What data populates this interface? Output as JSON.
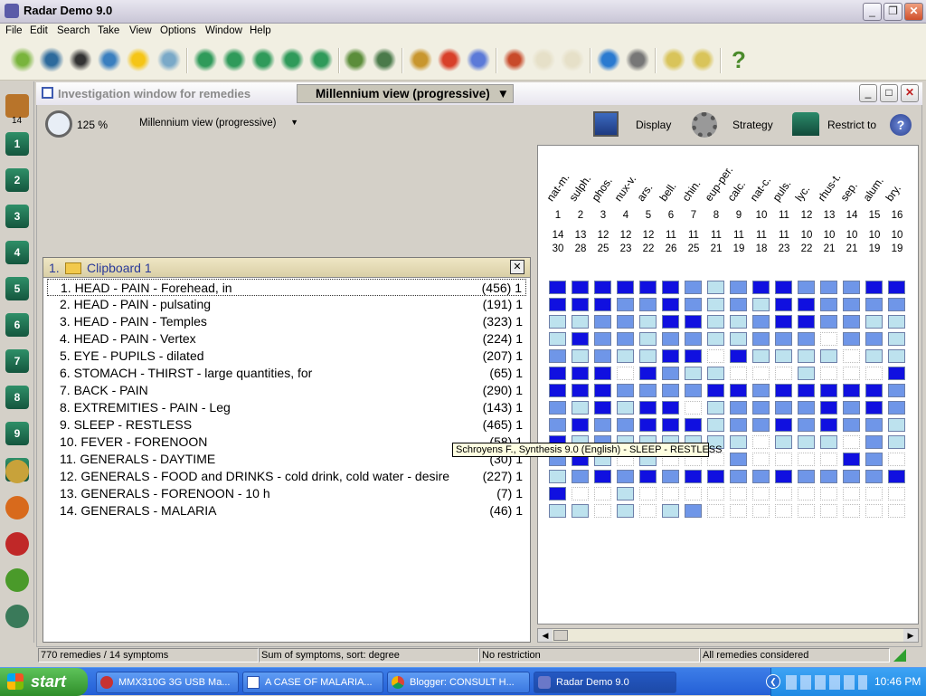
{
  "window": {
    "title": "Radar Demo 9.0"
  },
  "menu": [
    "File",
    "Edit",
    "Search",
    "Take",
    "View",
    "Options",
    "Window",
    "Help"
  ],
  "toolbar_icons": [
    "open-book-icon",
    "binoculars-icon",
    "glasses-icon",
    "magnifier-icon",
    "lightbulb-icon",
    "stopwatch-icon",
    "clip-1-icon",
    "clip-2-icon",
    "clip-3-icon",
    "clip-4-icon",
    "clip-5-icon",
    "chart-icon",
    "test-tubes-icon",
    "target-icon",
    "pie-icon",
    "circle-icon",
    "pencil-icon",
    "scroll-icon",
    "scroll2-icon",
    "globe-icon",
    "printer-icon",
    "chip-icon",
    "chip2-icon",
    "help-icon"
  ],
  "left_toolbar": {
    "clipboard_count": "14",
    "items": [
      "1",
      "2",
      "3",
      "4",
      "5",
      "6",
      "7",
      "8",
      "9",
      "10"
    ]
  },
  "inner": {
    "inactive_tab": "Investigation window for remedies",
    "active_tab": "Millennium view (progressive)",
    "zoom": "125 %",
    "view_select": "Millennium view (progressive)",
    "display": "Display",
    "strategy": "Strategy",
    "restrict": "Restrict to"
  },
  "clipboard": {
    "number": "1.",
    "title": "Clipboard 1",
    "rows": [
      {
        "label": "1. HEAD - PAIN - Forehead, in",
        "count": "(456) 1"
      },
      {
        "label": "2. HEAD - PAIN - pulsating",
        "count": "(191) 1"
      },
      {
        "label": "3. HEAD - PAIN - Temples",
        "count": "(323) 1"
      },
      {
        "label": "4. HEAD - PAIN - Vertex",
        "count": "(224) 1"
      },
      {
        "label": "5. EYE - PUPILS - dilated",
        "count": "(207) 1"
      },
      {
        "label": "6. STOMACH - THIRST - large quantities, for",
        "count": "(65) 1"
      },
      {
        "label": "7. BACK - PAIN",
        "count": "(290) 1"
      },
      {
        "label": "8. EXTREMITIES - PAIN - Leg",
        "count": "(143) 1"
      },
      {
        "label": "9. SLEEP - RESTLESS",
        "count": "(465) 1"
      },
      {
        "label": "10. FEVER - FORENOON",
        "count": "(58) 1"
      },
      {
        "label": "11. GENERALS - DAYTIME",
        "count": "(30) 1"
      },
      {
        "label": "12. GENERALS - FOOD and DRINKS - cold drink, cold water - desire",
        "count": "(227) 1"
      },
      {
        "label": "13. GENERALS - FORENOON - 10 h",
        "count": "(7) 1"
      },
      {
        "label": "14. GENERALS - MALARIA",
        "count": "(46) 1"
      }
    ]
  },
  "grid": {
    "remedies": [
      "nat-m.",
      "sulph.",
      "phos.",
      "nux-v.",
      "ars.",
      "bell.",
      "chin.",
      "eup-per.",
      "calc.",
      "nat-c.",
      "puls.",
      "lyc.",
      "rhus-t.",
      "sep.",
      "alum.",
      "bry."
    ],
    "ranks": [
      "1",
      "2",
      "3",
      "4",
      "5",
      "6",
      "7",
      "8",
      "9",
      "10",
      "11",
      "12",
      "13",
      "14",
      "15",
      "16"
    ],
    "symptom_counts": [
      "14",
      "13",
      "12",
      "12",
      "12",
      "11",
      "11",
      "11",
      "11",
      "11",
      "11",
      "10",
      "10",
      "10",
      "10",
      "10"
    ],
    "degrees": [
      "30",
      "28",
      "25",
      "23",
      "22",
      "26",
      "25",
      "21",
      "19",
      "18",
      "23",
      "22",
      "21",
      "21",
      "19",
      "19"
    ],
    "levels": [
      [
        3,
        3,
        3,
        3,
        3,
        3,
        2,
        1,
        2,
        3,
        3,
        2,
        2,
        2,
        3,
        3
      ],
      [
        3,
        3,
        3,
        2,
        2,
        3,
        2,
        1,
        2,
        1,
        3,
        3,
        2,
        2,
        2,
        2
      ],
      [
        1,
        1,
        2,
        2,
        1,
        3,
        3,
        1,
        1,
        2,
        3,
        3,
        2,
        2,
        1,
        1
      ],
      [
        1,
        3,
        2,
        2,
        1,
        2,
        2,
        1,
        1,
        2,
        2,
        2,
        0,
        2,
        2,
        1
      ],
      [
        2,
        1,
        2,
        1,
        1,
        3,
        3,
        0,
        3,
        1,
        1,
        1,
        1,
        0,
        1,
        1
      ],
      [
        3,
        3,
        3,
        0,
        3,
        2,
        1,
        1,
        0,
        0,
        0,
        1,
        0,
        0,
        0,
        3
      ],
      [
        3,
        3,
        3,
        2,
        2,
        2,
        2,
        3,
        3,
        2,
        3,
        3,
        3,
        3,
        3,
        2
      ],
      [
        2,
        1,
        3,
        1,
        3,
        3,
        0,
        1,
        2,
        2,
        2,
        2,
        3,
        2,
        3,
        2
      ],
      [
        2,
        3,
        2,
        2,
        3,
        3,
        3,
        1,
        2,
        2,
        3,
        2,
        3,
        2,
        2,
        1
      ],
      [
        3,
        1,
        2,
        1,
        1,
        1,
        1,
        1,
        1,
        0,
        1,
        1,
        1,
        0,
        2,
        1
      ],
      [
        2,
        3,
        1,
        0,
        1,
        0,
        0,
        0,
        2,
        0,
        0,
        0,
        0,
        3,
        2,
        0
      ],
      [
        1,
        2,
        3,
        2,
        3,
        2,
        3,
        3,
        2,
        2,
        3,
        2,
        2,
        2,
        2,
        3
      ],
      [
        3,
        0,
        0,
        1,
        0,
        0,
        0,
        0,
        0,
        0,
        0,
        0,
        0,
        0,
        0,
        0
      ],
      [
        1,
        1,
        0,
        1,
        0,
        1,
        2,
        0,
        0,
        0,
        0,
        0,
        0,
        0,
        0,
        0
      ]
    ]
  },
  "tooltip": "Schroyens F., Synthesis 9.0 (English) - SLEEP - RESTLESS",
  "status": {
    "remedies": "770 remedies / 14 symptoms",
    "sort": "Sum of symptoms, sort: degree",
    "restriction": "No restriction",
    "considered": "All remedies considered"
  },
  "taskbar": {
    "start": "start",
    "tasks": [
      "MMX310G 3G USB Ma...",
      "A CASE OF MALARIA...",
      "Blogger: CONSULT H...",
      "Radar Demo 9.0"
    ],
    "clock": "10:46 PM"
  },
  "colors": {
    "level3": "#1010e0",
    "level2": "#6f96e8",
    "level1": "#bde2ee",
    "level0": "#ffffff"
  }
}
